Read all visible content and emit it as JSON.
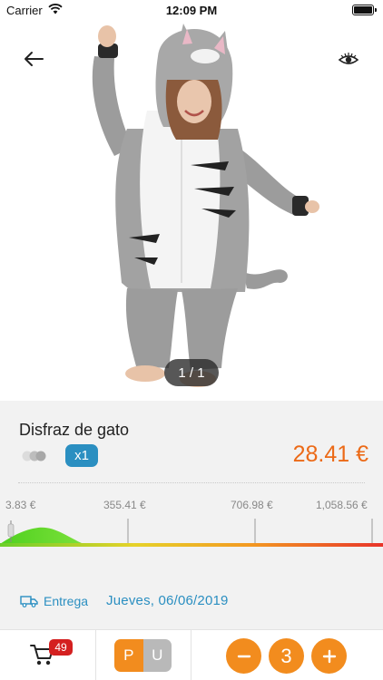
{
  "status_bar": {
    "carrier": "Carrier",
    "time": "12:09 PM"
  },
  "product": {
    "image_pager": "1 / 1",
    "title": "Disfraz de gato",
    "quantity_badge": "x1",
    "price": "28.41 €"
  },
  "price_scale": {
    "ticks": [
      "3.83 €",
      "355.41 €",
      "706.98 €",
      "1,058.56 €"
    ]
  },
  "delivery": {
    "label": "Entrega",
    "date": "Jueves, 06/06/2019"
  },
  "bottom_bar": {
    "cart_count": "49",
    "unit_p": "P",
    "unit_u": "U",
    "quantity": "3"
  },
  "icons": {
    "back": "arrow-left-icon",
    "view": "eye-icon",
    "delivery": "truck-icon",
    "cart": "cart-icon",
    "minus": "minus-icon",
    "plus": "plus-icon"
  },
  "colors": {
    "accent_orange": "#f28c1e",
    "price_orange": "#ec6a17",
    "accent_blue": "#2b8fc1",
    "badge_red": "#d42020"
  }
}
